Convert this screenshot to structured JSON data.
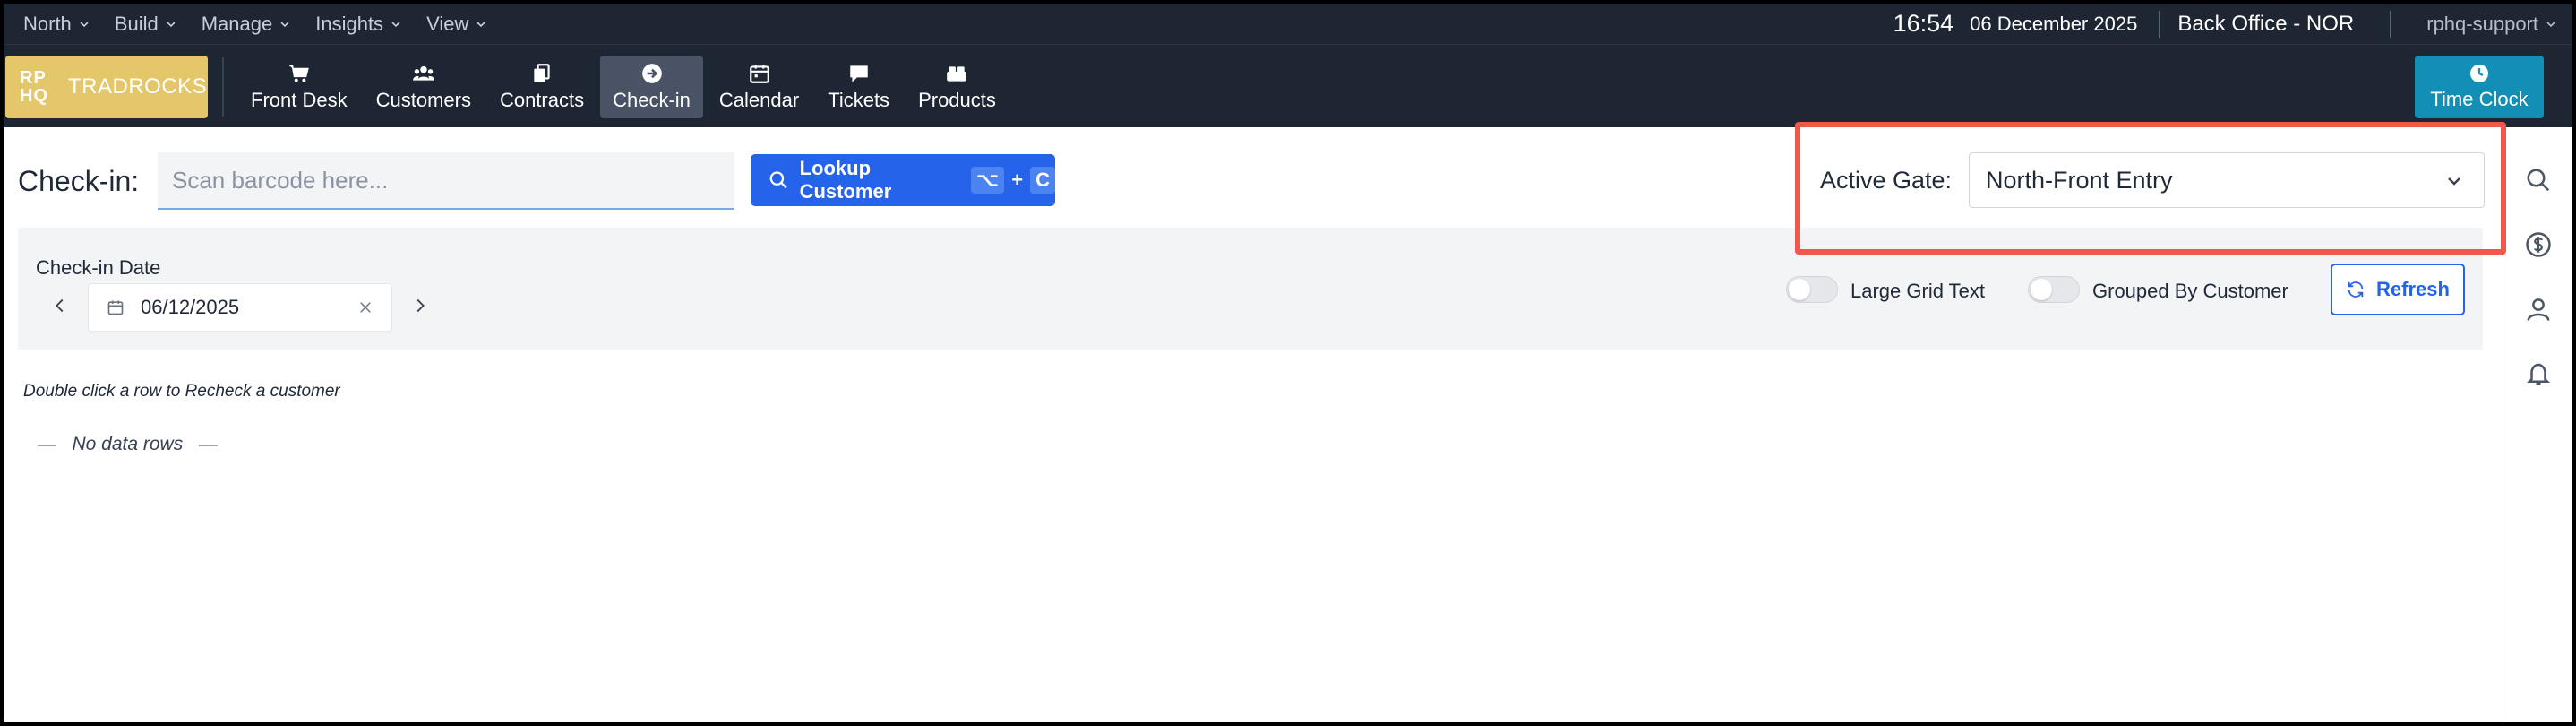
{
  "topbar": {
    "menus": [
      {
        "label": "North"
      },
      {
        "label": "Build"
      },
      {
        "label": "Manage"
      },
      {
        "label": "Insights"
      },
      {
        "label": "View"
      }
    ],
    "time": "16:54",
    "date": "06 December 2025",
    "office": "Back Office - NOR",
    "user": "rphq-support"
  },
  "logo": {
    "mark_line1": "RP",
    "mark_line2": "HQ",
    "name": "TRADROCKS",
    "color": "#e3c76a"
  },
  "nav": {
    "items": [
      {
        "label": "Front Desk",
        "icon": "cart-icon"
      },
      {
        "label": "Customers",
        "icon": "users-icon"
      },
      {
        "label": "Contracts",
        "icon": "contracts-icon"
      },
      {
        "label": "Check-in",
        "icon": "checkin-icon",
        "active": true
      },
      {
        "label": "Calendar",
        "icon": "calendar-icon"
      },
      {
        "label": "Tickets",
        "icon": "ticket-icon"
      },
      {
        "label": "Products",
        "icon": "products-icon"
      }
    ],
    "time_clock": "Time Clock"
  },
  "checkin": {
    "label": "Check-in:",
    "scan_placeholder": "Scan barcode here...",
    "lookup_label": "Lookup Customer",
    "shortcut_key1": "⌥",
    "shortcut_plus": "+",
    "shortcut_key2": "C"
  },
  "gate": {
    "label": "Active Gate:",
    "value": "North-Front Entry",
    "highlight_color": "#f0584a"
  },
  "filters": {
    "date_label": "Check-in Date",
    "date_value": "06/12/2025",
    "large_grid_label": "Large Grid Text",
    "grouped_label": "Grouped By Customer",
    "refresh_label": "Refresh"
  },
  "grid": {
    "hint": "Double click a row to Recheck a customer",
    "empty": "—   No data rows   —"
  },
  "colors": {
    "navbar": "#1e2533",
    "primary": "#2563eb",
    "time_clock": "#138fb6"
  }
}
